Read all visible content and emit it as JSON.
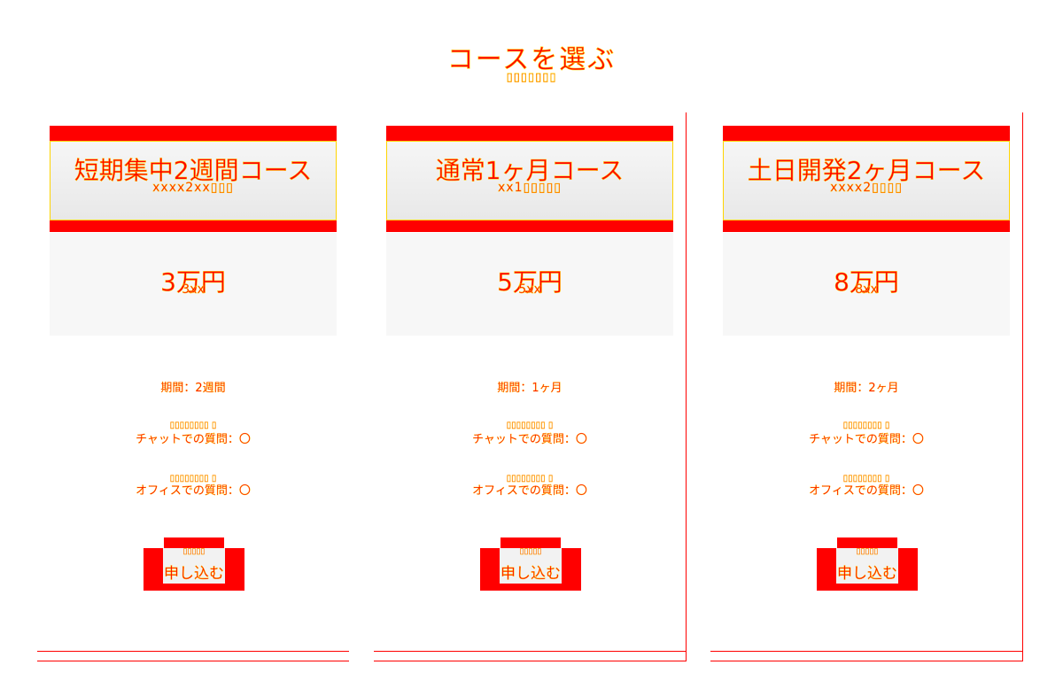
{
  "header": {
    "title": "コースを選ぶ",
    "subtitle": "▯▯▯▯▯▯▯"
  },
  "colors": {
    "accent": "#ff0000",
    "outline": "#ffd400",
    "panel": "#f2f2f2"
  },
  "courses": [
    {
      "name": "短期集中2週間コース",
      "name_sub": "xxxx2xx▯▯▯",
      "price": "3万円",
      "price_sub": "3xx",
      "period": "期間：2週間",
      "chat_hint": "▯▯▯▯▯▯▯▯ ▯",
      "chat": "チャットでの質問：〇",
      "office_hint": "▯▯▯▯▯▯▯▯ ▯",
      "office": "オフィスでの質問：〇",
      "apply_hint": "▯▯▯▯▯",
      "apply_label": "申し込む"
    },
    {
      "name": "通常1ヶ月コース",
      "name_sub": "xx1▯▯▯▯▯",
      "price": "5万円",
      "price_sub": "5xx",
      "period": "期間：1ヶ月",
      "chat_hint": "▯▯▯▯▯▯▯▯ ▯",
      "chat": "チャットでの質問：〇",
      "office_hint": "▯▯▯▯▯▯▯▯ ▯",
      "office": "オフィスでの質問：〇",
      "apply_hint": "▯▯▯▯▯",
      "apply_label": "申し込む"
    },
    {
      "name": "土日開発2ヶ月コース",
      "name_sub": "xxxx2▯▯▯▯",
      "price": "8万円",
      "price_sub": "8xx",
      "period": "期間：2ヶ月",
      "chat_hint": "▯▯▯▯▯▯▯▯ ▯",
      "chat": "チャットでの質問：〇",
      "office_hint": "▯▯▯▯▯▯▯▯ ▯",
      "office": "オフィスでの質問：〇",
      "apply_hint": "▯▯▯▯▯",
      "apply_label": "申し込む"
    }
  ]
}
